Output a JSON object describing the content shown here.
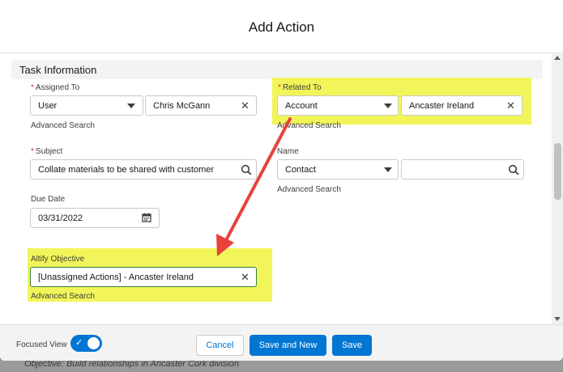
{
  "modal": {
    "title": "Add Action"
  },
  "section": {
    "title": "Task Information"
  },
  "assigned_to": {
    "label": "Assigned To",
    "type_value": "User",
    "value": "Chris McGann",
    "advanced_search": "Advanced Search"
  },
  "related_to": {
    "label": "Related To",
    "type_value": "Account",
    "value": "Ancaster Ireland",
    "advanced_search": "Advanced Search"
  },
  "subject": {
    "label": "Subject",
    "value": "Collate materials to be shared with customer"
  },
  "name": {
    "label": "Name",
    "type_value": "Contact",
    "value": "",
    "advanced_search": "Advanced Search"
  },
  "due_date": {
    "label": "Due Date",
    "value": "03/31/2022"
  },
  "objective": {
    "label": "Altify Objective",
    "value": "[Unassigned Actions] - Ancaster Ireland",
    "advanced_search": "Advanced Search"
  },
  "footer": {
    "focused_view_label": "Focused View",
    "cancel": "Cancel",
    "save_and_new": "Save and New",
    "save": "Save"
  },
  "background": {
    "text": "Objective: Build relationships in Ancaster Cork division"
  },
  "colors": {
    "highlight": "#f2f55a",
    "brand": "#0176d3",
    "arrow": "#e8413a"
  }
}
